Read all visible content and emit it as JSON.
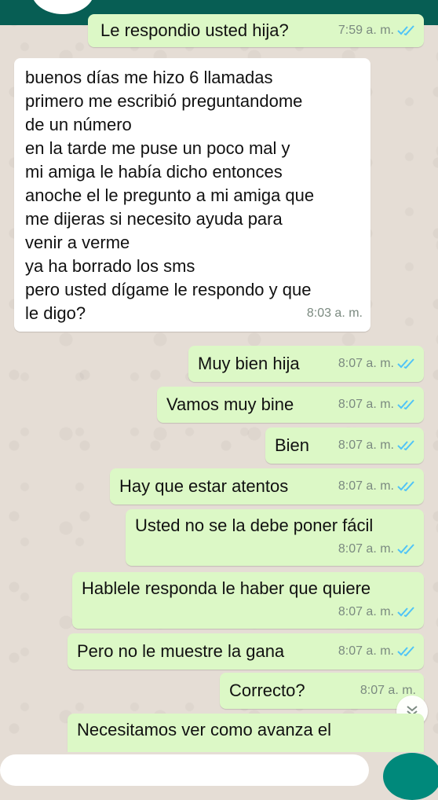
{
  "messages": [
    {
      "text": "Le respondio usted hija?",
      "time": "7:59 a. m.",
      "read": true
    },
    {
      "text": "buenos días me hizo 6 llamadas\nprimero me escribió preguntandome\nde un número\nen la tarde me puse un poco mal y\nmi amiga le había dicho entonces\nanoche el le pregunto a mi amiga que\nme dijeras si necesito ayuda para\nvenir a verme\nya ha borrado los sms\npero usted dígame le respondo y que\nle digo?",
      "time": "8:03 a. m."
    },
    {
      "text": "Muy bien hija",
      "time": "8:07 a. m.",
      "read": true
    },
    {
      "text": "Vamos muy bine",
      "time": "8:07 a. m.",
      "read": true
    },
    {
      "text": "Bien",
      "time": "8:07 a. m.",
      "read": true
    },
    {
      "text": "Hay que estar atentos",
      "time": "8:07 a. m.",
      "read": true
    },
    {
      "text": "Usted no se la debe poner fácil",
      "time": "8:07 a. m.",
      "read": true
    },
    {
      "text": "Hablele responda le haber que quiere",
      "time": "8:07 a. m.",
      "read": true
    },
    {
      "text": "Pero no le muestre la gana",
      "time": "8:07 a. m.",
      "read": true
    },
    {
      "text": "Correcto?",
      "time": "8:07 a. m.",
      "read": true
    },
    {
      "text": "Necesitamos ver como avanza el"
    }
  ],
  "colors": {
    "outgoing": "#dcf8c6",
    "incoming": "#ffffff",
    "read_ticks": "#4fc3f7",
    "header": "#075e54"
  },
  "icons": {
    "read_receipt": "double-check-icon",
    "scroll": "double-chevron-down-icon"
  }
}
